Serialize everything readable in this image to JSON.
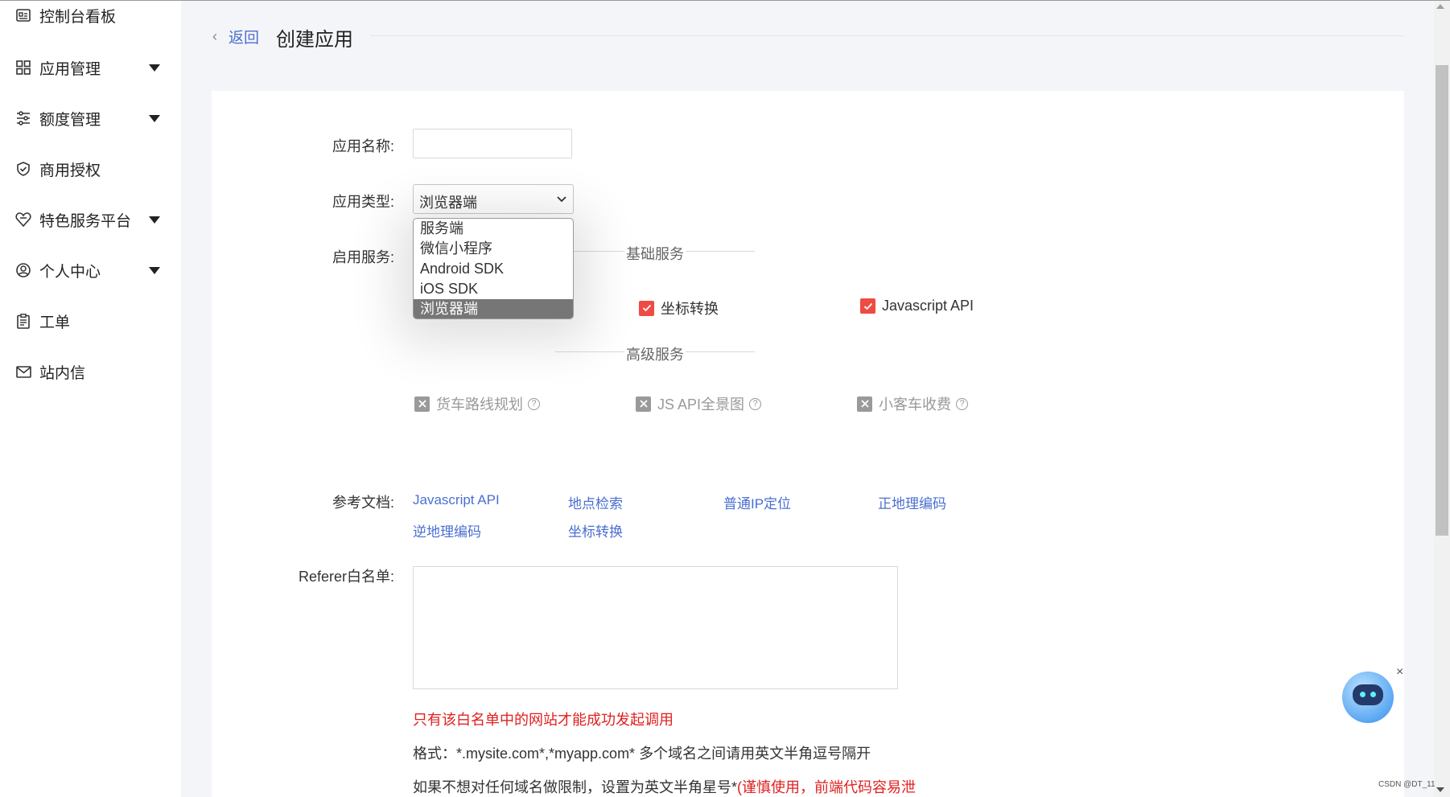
{
  "sidebar": {
    "items": [
      {
        "label": "控制台看板",
        "icon": "dashboard-card-icon",
        "expandable": false
      },
      {
        "label": "应用管理",
        "icon": "grid-apps-icon",
        "expandable": true
      },
      {
        "label": "额度管理",
        "icon": "sliders-icon",
        "expandable": true
      },
      {
        "label": "商用授权",
        "icon": "shield-check-icon",
        "expandable": false
      },
      {
        "label": "特色服务平台",
        "icon": "heart-shield-icon",
        "expandable": true
      },
      {
        "label": "个人中心",
        "icon": "user-circle-icon",
        "expandable": true
      },
      {
        "label": "工单",
        "icon": "clipboard-icon",
        "expandable": false
      },
      {
        "label": "站内信",
        "icon": "mail-icon",
        "expandable": false
      }
    ]
  },
  "header": {
    "back_label": "返回",
    "title": "创建应用"
  },
  "form": {
    "app_name_label": "应用名称:",
    "app_name_value": "",
    "app_type_label": "应用类型:",
    "app_type_value": "浏览器端",
    "app_type_options": [
      "服务端",
      "微信小程序",
      "Android SDK",
      "iOS SDK",
      "浏览器端"
    ],
    "services_label": "启用服务:",
    "basic_services_title": "基础服务",
    "basic_services": [
      {
        "label": "坐标转换",
        "checked": true
      },
      {
        "label": "Javascript API",
        "checked": true
      }
    ],
    "advanced_services_title": "高级服务",
    "advanced_services": [
      {
        "label": "货车路线规划",
        "checked": false
      },
      {
        "label": "JS API全景图",
        "checked": false
      },
      {
        "label": "小客车收费",
        "checked": false
      }
    ],
    "docs_label": "参考文档:",
    "docs": [
      "Javascript API",
      "地点检索",
      "普通IP定位",
      "正地理编码",
      "逆地理编码",
      "坐标转换"
    ],
    "referer_label": "Referer白名单:",
    "referer_value": "",
    "note_warning": "只有该白名单中的网站才能成功发起调用",
    "note_format": "格式：*.mysite.com*,*myapp.com* 多个域名之间请用英文半角逗号隔开",
    "note_nolimit": "如果不想对任何域名做限制，设置为英文半角星号*",
    "note_nolimit_warn": "(谨慎使用，前端代码容易泄"
  },
  "help_glyph": "?",
  "close_glyph": "×",
  "watermark": "CSDN @DT_11",
  "colors": {
    "accent_link": "#4a6fd0",
    "checkbox_on": "#ee4c43",
    "checkbox_off": "#9a9a9a",
    "warning_text": "#e02020"
  }
}
